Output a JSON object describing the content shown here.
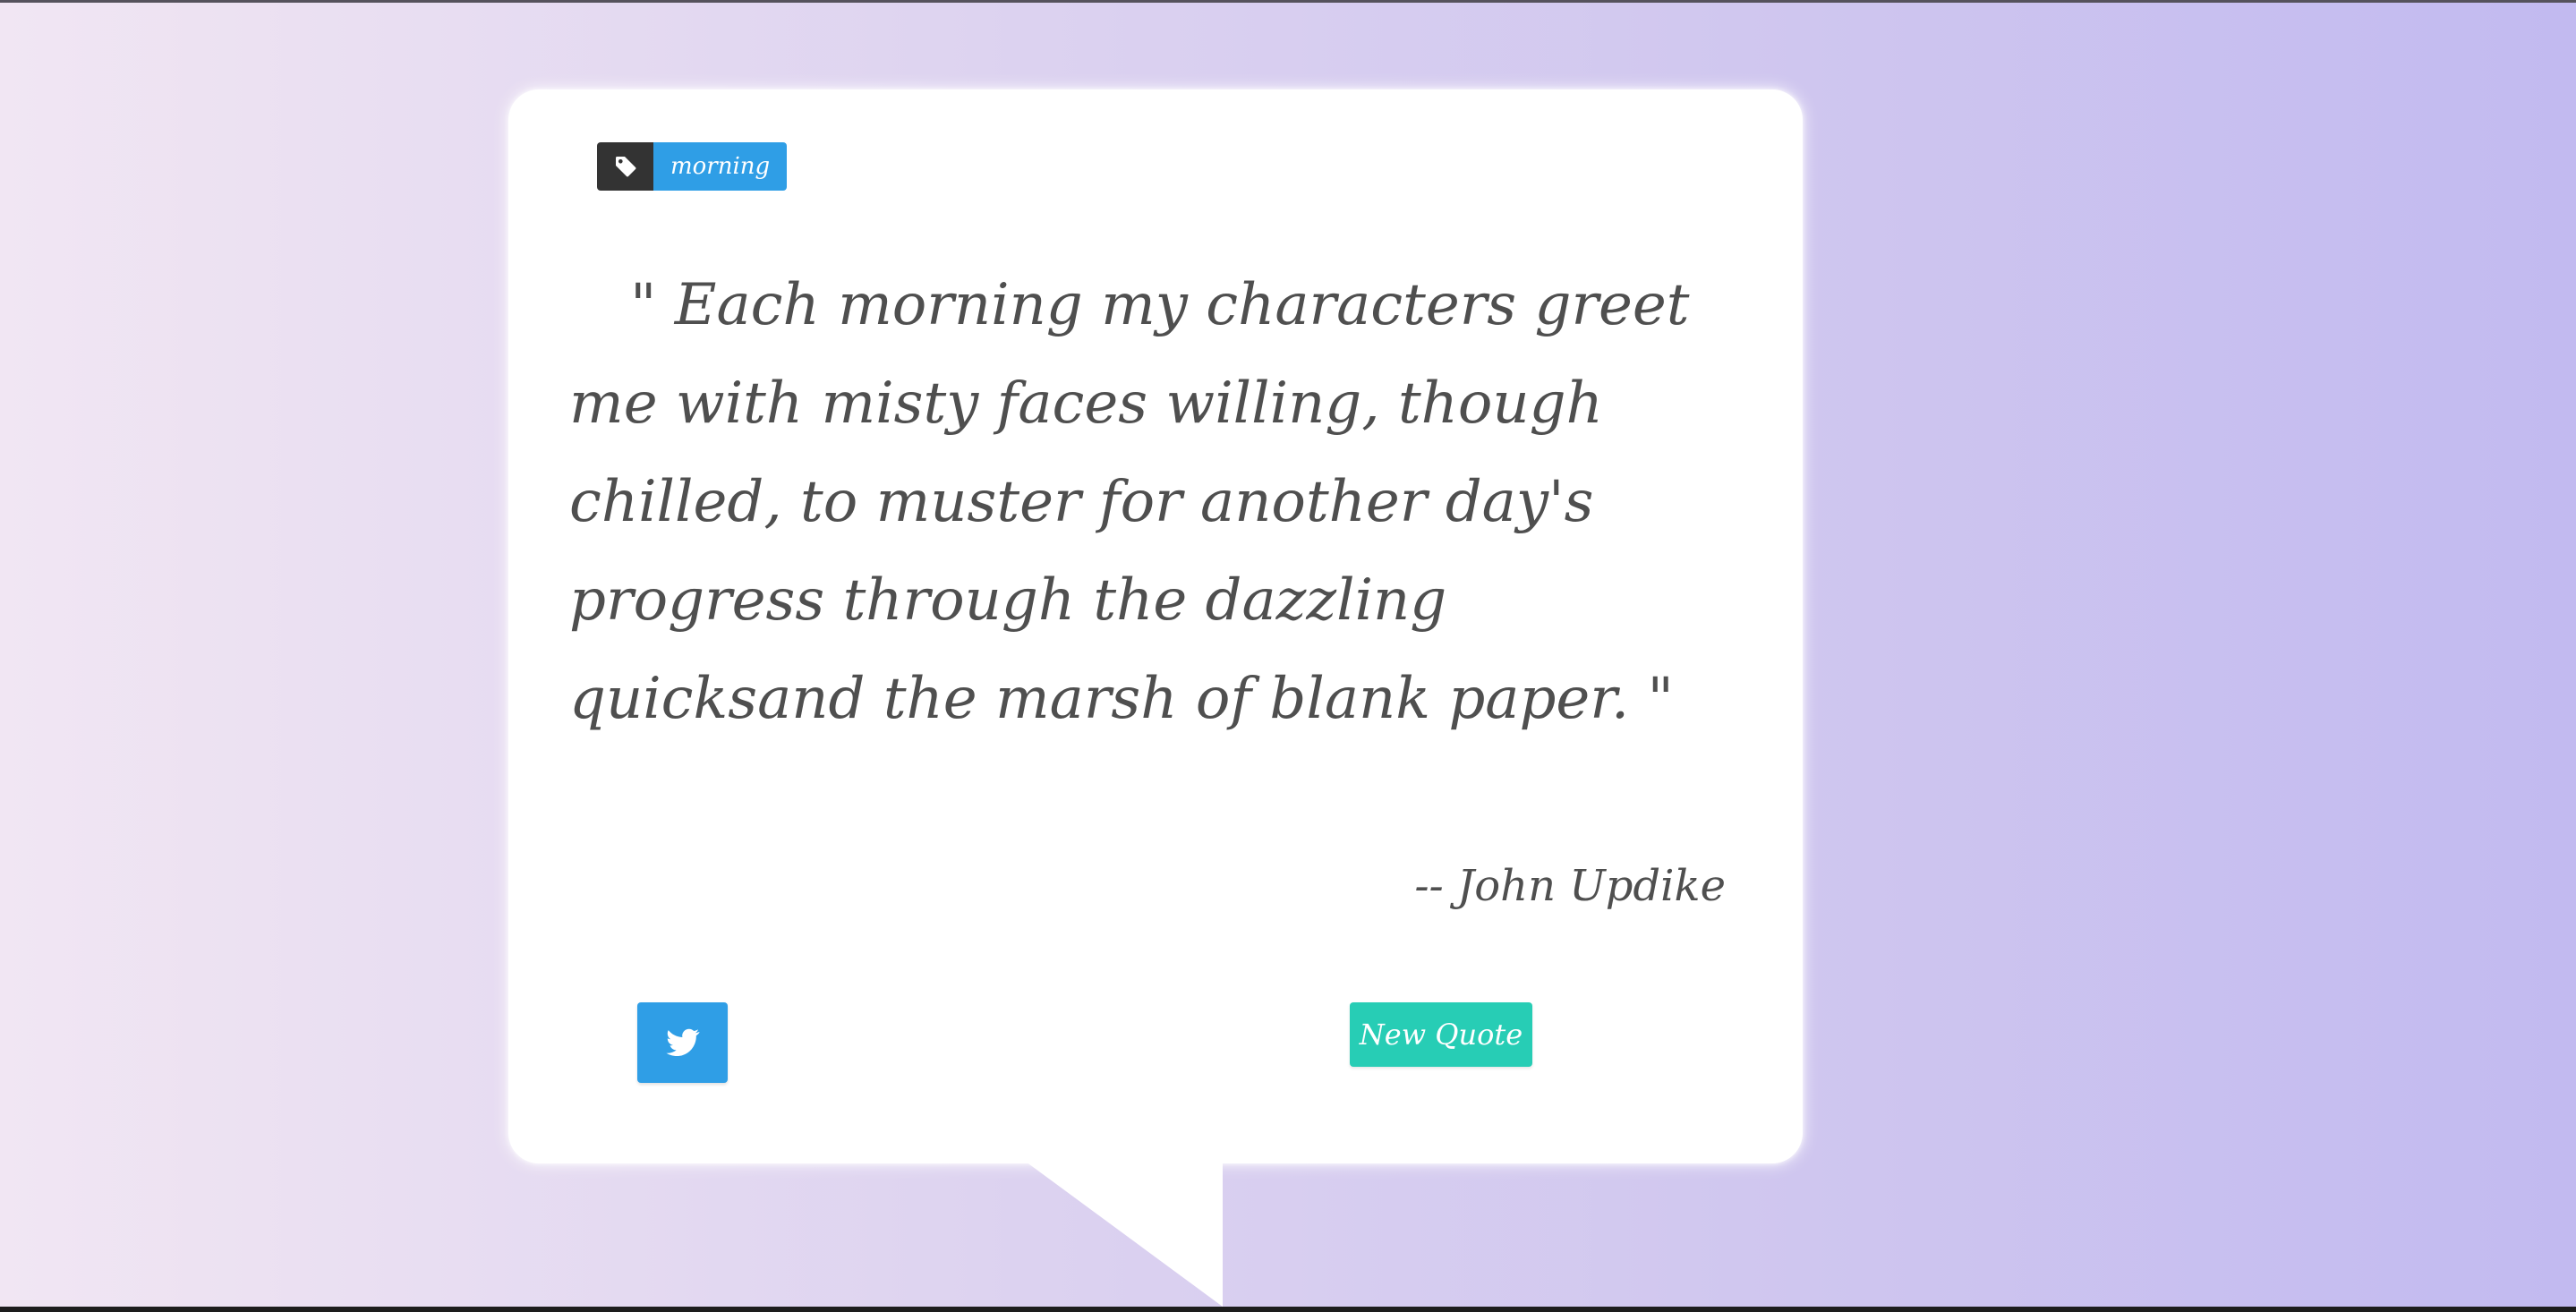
{
  "tag": {
    "icon": "tag-icon",
    "label": "morning"
  },
  "quote": {
    "text": "\" Each morning my characters greet me with misty faces willing, though chilled, to muster for another day's progress through the dazzling quicksand the marsh of blank paper. \"",
    "author": "-- John Updike"
  },
  "actions": {
    "tweet_icon": "twitter-icon",
    "new_quote_label": "New Quote"
  },
  "colors": {
    "tag_dark": "#333333",
    "tag_blue": "#2f9ee6",
    "tweet_blue": "#2f9ee6",
    "new_quote_teal": "#27cdb5",
    "text": "#4f4f4f",
    "background_left": "#f1e6f3",
    "background_right": "#c2baf0"
  }
}
